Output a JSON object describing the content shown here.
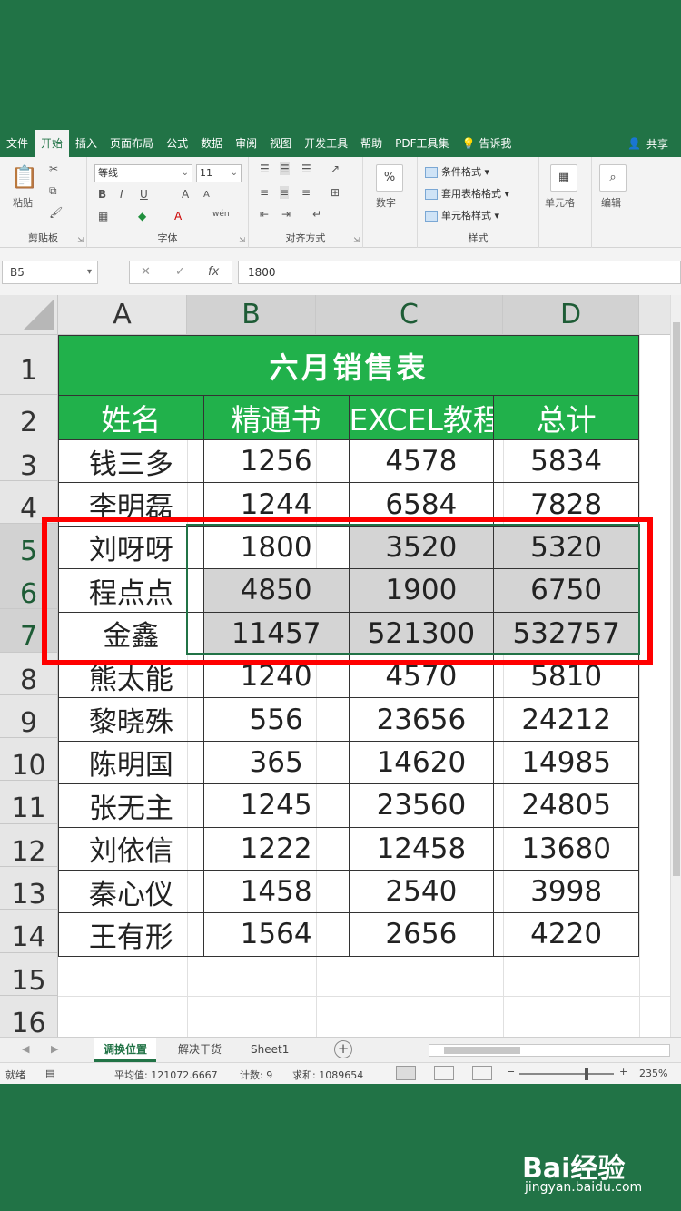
{
  "ribbon_tabs": [
    "文件",
    "开始",
    "插入",
    "页面布局",
    "公式",
    "数据",
    "审阅",
    "视图",
    "开发工具",
    "帮助",
    "PDF工具集"
  ],
  "ribbon_active_tab": "开始",
  "tell_me": "告诉我",
  "share": "共享",
  "ribbon": {
    "clipboard": {
      "paste": "粘贴",
      "label": "剪贴板"
    },
    "font": {
      "family": "等线",
      "size": "11",
      "label": "字体",
      "bold": "B",
      "italic": "I",
      "underline": "U",
      "grow": "A",
      "shrink": "A",
      "color_a": "A",
      "wen": "wén"
    },
    "alignment": {
      "label": "对齐方式"
    },
    "number": {
      "button": "数字",
      "symbol": "%"
    },
    "styles": {
      "conditional": "条件格式",
      "table": "套用表格格式",
      "cell": "单元格样式",
      "label": "样式"
    },
    "cells": {
      "button": "单元格"
    },
    "editing": {
      "button": "编辑"
    }
  },
  "formula_bar": {
    "name_box": "B5",
    "cancel": "✕",
    "enter": "✓",
    "fx": "fx",
    "value": "1800"
  },
  "columns": [
    "A",
    "B",
    "C",
    "D"
  ],
  "selected_columns": [
    "B",
    "C",
    "D"
  ],
  "rows": [
    "1",
    "2",
    "3",
    "4",
    "5",
    "6",
    "7",
    "8",
    "9",
    "10",
    "11",
    "12",
    "13",
    "14",
    "15",
    "16"
  ],
  "selected_rows": [
    "5",
    "6",
    "7"
  ],
  "table": {
    "title": "六月销售表",
    "headers": [
      "姓名",
      "精通书",
      "EXCEL教程",
      "总计"
    ],
    "rows": [
      [
        "钱三多",
        "1256",
        "4578",
        "5834"
      ],
      [
        "李明磊",
        "1244",
        "6584",
        "7828"
      ],
      [
        "刘呀呀",
        "1800",
        "3520",
        "5320"
      ],
      [
        "程点点",
        "4850",
        "1900",
        "6750"
      ],
      [
        "金鑫",
        "11457",
        "521300",
        "532757"
      ],
      [
        "熊太能",
        "1240",
        "4570",
        "5810"
      ],
      [
        "黎晓殊",
        "556",
        "23656",
        "24212"
      ],
      [
        "陈明国",
        "365",
        "14620",
        "14985"
      ],
      [
        "张无主",
        "1245",
        "23560",
        "24805"
      ],
      [
        "刘依信",
        "1222",
        "12458",
        "13680"
      ],
      [
        "秦心仪",
        "1458",
        "2540",
        "3998"
      ],
      [
        "王有形",
        "1564",
        "2656",
        "4220"
      ]
    ]
  },
  "sheet_tabs": [
    "调换位置",
    "解决干货",
    "Sheet1"
  ],
  "active_sheet": "调换位置",
  "status_bar": {
    "ready": "就绪",
    "average": "平均值: 121072.6667",
    "count": "计数: 9",
    "sum": "求和: 1089654",
    "zoom": "235%",
    "zoom_minus": "−",
    "zoom_plus": "+"
  },
  "watermark": {
    "logo": "Bai经验",
    "url": "jingyan.baidu.com"
  },
  "colors": {
    "excel_green": "#217346",
    "header_fill": "#21b14b",
    "highlight_box": "#ff0000",
    "selection_fill": "#d4d4d4"
  }
}
